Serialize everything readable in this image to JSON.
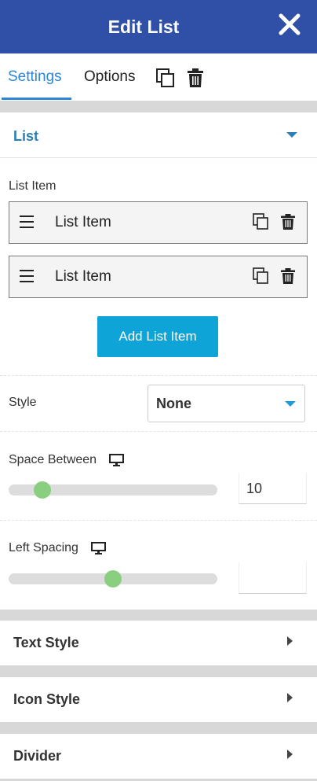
{
  "header": {
    "title": "Edit List",
    "close_icon": "close-icon"
  },
  "tabs": {
    "settings": "Settings",
    "options": "Options"
  },
  "colors": {
    "header_bg": "#3050a8",
    "accent": "#2d86d6",
    "button_bg": "#0ea4d8",
    "slider_thumb": "#8acf80"
  },
  "list_section": {
    "title": "List",
    "list_item_label": "List Item",
    "items": [
      {
        "label": "List Item"
      },
      {
        "label": "List Item"
      }
    ],
    "add_button": "Add List Item",
    "style_label": "Style",
    "style_value": "None",
    "space_between_label": "Space Between",
    "space_between_value": "10",
    "space_between_fraction": 0.13,
    "left_spacing_label": "Left Spacing",
    "left_spacing_value": "",
    "left_spacing_fraction": 0.5
  },
  "collapsed_sections": [
    {
      "title": "Text Style"
    },
    {
      "title": "Icon Style"
    },
    {
      "title": "Divider"
    }
  ]
}
